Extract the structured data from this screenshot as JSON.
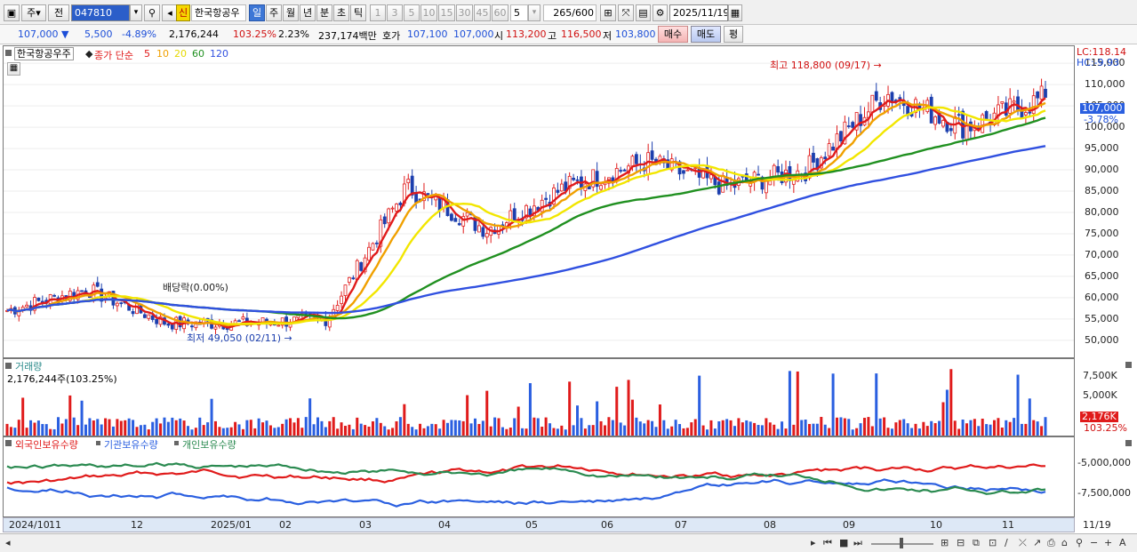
{
  "toolbar": {
    "period_label": "주",
    "prev_label": "전",
    "code_value": "047810",
    "badge_label": "신",
    "stock_name": "한국항공우",
    "period_buttons": [
      "일",
      "주",
      "월",
      "년",
      "분",
      "초",
      "틱"
    ],
    "active_period": "일",
    "interval_buttons": [
      "1",
      "3",
      "5",
      "10",
      "15",
      "30",
      "45",
      "60"
    ],
    "interval_value": "5",
    "count_value": "265",
    "count_total": "/600",
    "date_value": "2025/11/19"
  },
  "quote": {
    "price": "107,000",
    "change": "5,500",
    "change_rate": "-4.89%",
    "volume": "2,176,244",
    "volume_ratio": "103.25%",
    "turnover": "2.23%",
    "amount": "237,174백만",
    "bid_label": "호가",
    "bid_value": "107,100",
    "ask_value": "107,000",
    "open_label": "시",
    "open_value": "113,200",
    "high_label": "고",
    "high_value": "116,500",
    "low_label": "저",
    "low_value": "103,800",
    "buy_label": "매수",
    "sell_label": "매도",
    "eval_label": "평"
  },
  "price_panel": {
    "stock_tag": "한국항공우주",
    "ma_label": "종가 단순",
    "ma_periods": [
      "5",
      "10",
      "20",
      "60",
      "120"
    ],
    "ma_colors": [
      "#e01b1b",
      "#f0a000",
      "#f2e600",
      "#209020",
      "#3050e0"
    ],
    "lc": "LC:118.14",
    "hc": "HC:-9.93",
    "high_note": "최고 118,800 (09/17)",
    "low_note": "최저 49,050 (02/11)",
    "dividend_note": "배당락(0.00%)",
    "current_tag": "107,000",
    "current_rate": "-3.78%",
    "y_ticks": [
      "115,000",
      "110,000",
      "105,000",
      "100,000",
      "95,000",
      "90,000",
      "85,000",
      "80,000",
      "75,000",
      "70,000",
      "65,000",
      "60,000",
      "55,000",
      "50,000"
    ]
  },
  "volume_panel": {
    "title": "거래량",
    "detail": "2,176,244주(103.25%)",
    "y_ticks": [
      "7,500K",
      "5,000K"
    ],
    "current_tag": "2,176K",
    "current_rate": "103.25%"
  },
  "holding_panel": {
    "legends": [
      "외국인보유수량",
      "기관보유수량",
      "개인보유수량"
    ],
    "legend_colors": [
      "#e01b1b",
      "#2a5fe0",
      "#2a8a50"
    ],
    "y_ticks": [
      "-5,000,000",
      "-7,500,000"
    ]
  },
  "x_axis": {
    "labels": [
      "2024/10",
      "11",
      "12",
      "2025/01",
      "02",
      "03",
      "04",
      "05",
      "06",
      "07",
      "08",
      "09",
      "10",
      "11"
    ],
    "current": "11/19"
  },
  "chart_data": {
    "type": "candlestick",
    "title": "한국항공우주",
    "period": "daily",
    "x_range": [
      "2024/10",
      "2025/11/19"
    ],
    "y_range": [
      46000,
      119000
    ],
    "last_close": 107000,
    "high": {
      "value": 118800,
      "date": "09/17"
    },
    "low": {
      "value": 49050,
      "date": "02/11"
    },
    "close_trend_monthly": [
      {
        "month": "2024/10",
        "close": 57000
      },
      {
        "month": "2024/11",
        "close": 62000
      },
      {
        "month": "2024/12",
        "close": 54000
      },
      {
        "month": "2025/01",
        "close": 54000
      },
      {
        "month": "2025/02",
        "close": 55000
      },
      {
        "month": "2025/03",
        "close": 86000
      },
      {
        "month": "2025/04",
        "close": 76000
      },
      {
        "month": "2025/05",
        "close": 86000
      },
      {
        "month": "2025/06",
        "close": 92000
      },
      {
        "month": "2025/07",
        "close": 86000
      },
      {
        "month": "2025/08",
        "close": 90000
      },
      {
        "month": "2025/09",
        "close": 108000
      },
      {
        "month": "2025/10",
        "close": 100000
      },
      {
        "month": "2025/11",
        "close": 107000
      }
    ],
    "ma120_end": 96000,
    "ma60_end": 102000,
    "volume_last": 2176244
  }
}
